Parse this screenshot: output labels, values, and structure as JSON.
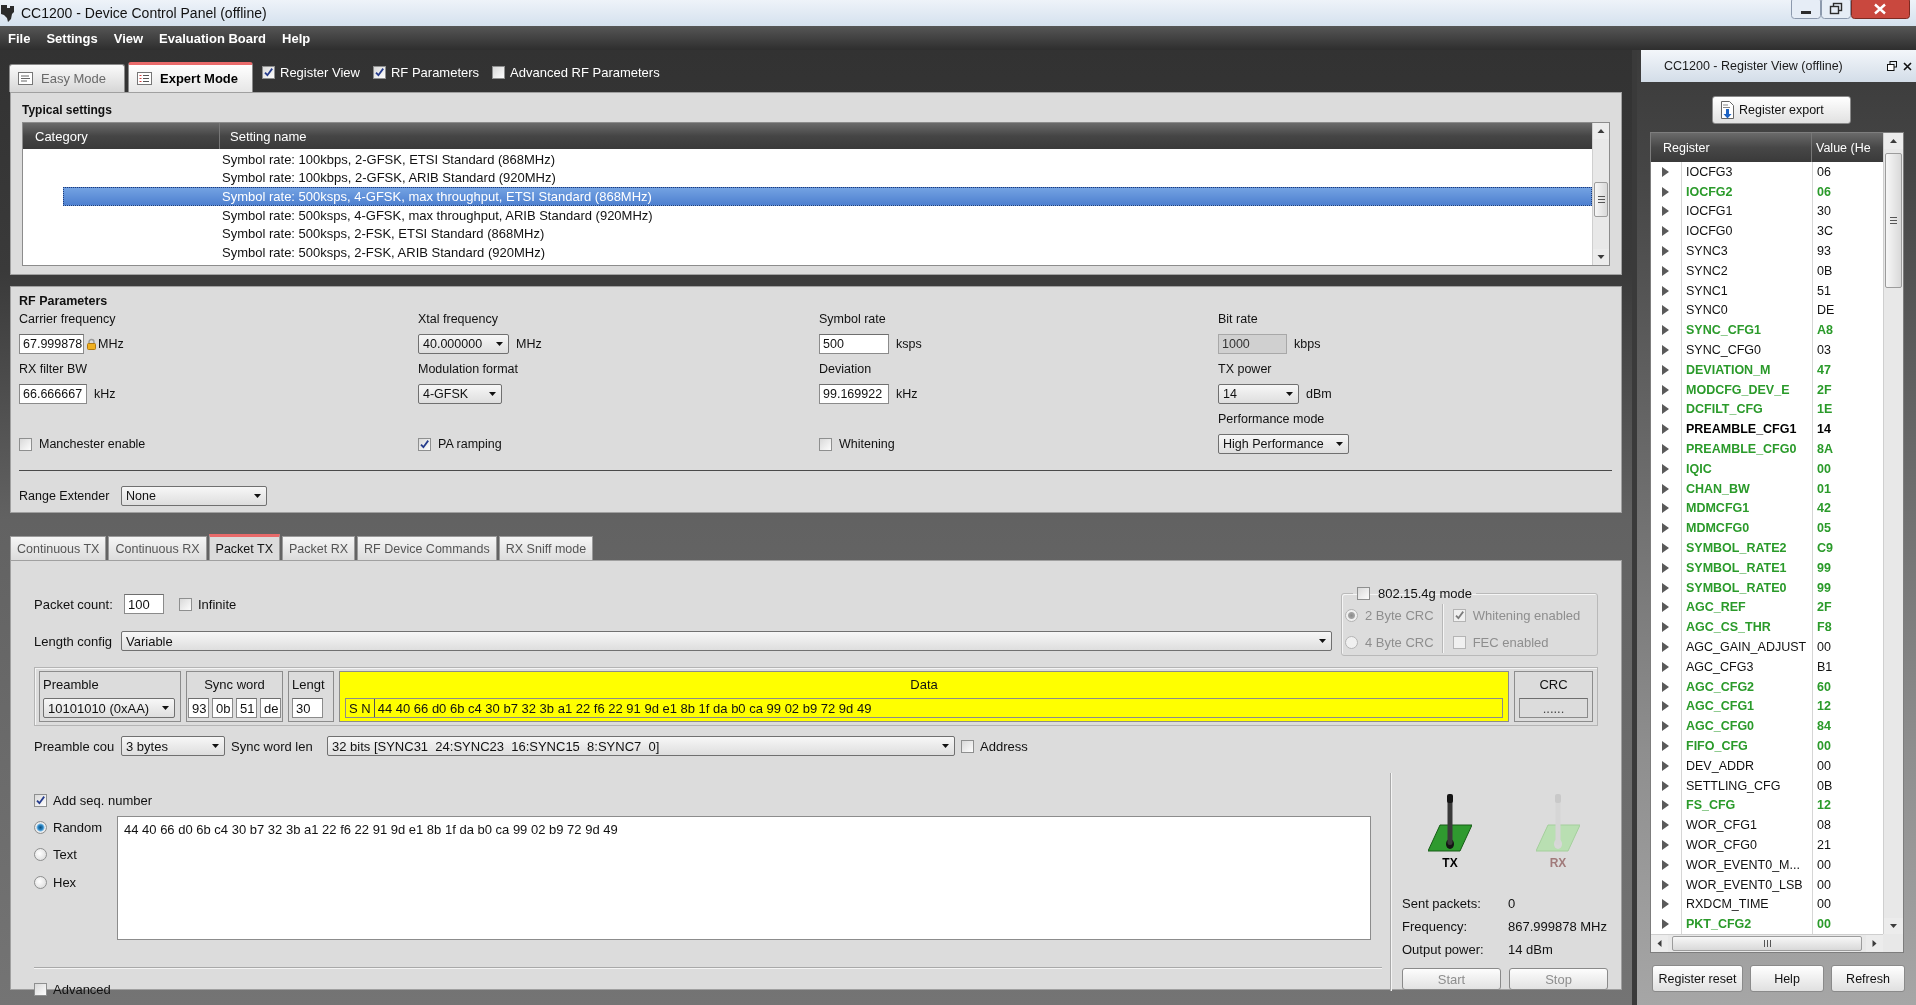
{
  "window": {
    "title": "CC1200 - Device Control Panel (offline)"
  },
  "menu": [
    "File",
    "Settings",
    "View",
    "Evaluation Board",
    "Help"
  ],
  "mode_tabs": [
    {
      "label": "Easy Mode",
      "selected": false
    },
    {
      "label": "Expert Mode",
      "selected": true
    }
  ],
  "view_options": [
    {
      "label": "Register View",
      "checked": true
    },
    {
      "label": "RF Parameters",
      "checked": true
    },
    {
      "label": "Advanced RF Parameters",
      "checked": false
    }
  ],
  "typical_settings": {
    "title": "Typical settings",
    "columns": [
      "Category",
      "Setting name"
    ],
    "rows": [
      {
        "setting_name": "Symbol rate: 100kbps, 2-GFSK, ETSI Standard (868MHz)",
        "selected": false
      },
      {
        "setting_name": "Symbol rate: 100kbps, 2-GFSK, ARIB Standard (920MHz)",
        "selected": false
      },
      {
        "setting_name": "Symbol rate: 500ksps, 4-GFSK, max throughput, ETSI Standard (868MHz)",
        "selected": true
      },
      {
        "setting_name": "Symbol rate: 500ksps, 4-GFSK, max throughput, ARIB Standard (920MHz)",
        "selected": false
      },
      {
        "setting_name": "Symbol rate: 500ksps, 2-FSK, ETSI Standard (868MHz)",
        "selected": false
      },
      {
        "setting_name": "Symbol rate: 500ksps, 2-FSK, ARIB Standard (920MHz)",
        "selected": false
      }
    ]
  },
  "rf_parameters": {
    "title": "RF Parameters",
    "fields": [
      {
        "kind": "input",
        "label": "Carrier frequency",
        "value": "67.999878",
        "unit": "MHz",
        "locked": true
      },
      {
        "kind": "select",
        "label": "Xtal frequency",
        "value": "40.000000",
        "unit": "MHz",
        "locked": false
      },
      {
        "kind": "input",
        "label": "Symbol rate",
        "value": "500",
        "unit": "ksps",
        "locked": false
      },
      {
        "kind": "readonly",
        "label": "Bit rate",
        "value": "1000",
        "unit": "kbps",
        "locked": false
      },
      {
        "kind": "input",
        "label": "RX filter BW",
        "value": "66.666667",
        "unit": "kHz",
        "locked": false
      },
      {
        "kind": "select",
        "label": "Modulation format",
        "value": "4-GFSK",
        "locked": false
      },
      {
        "kind": "input",
        "label": "Deviation",
        "value": "99.169922",
        "unit": "kHz",
        "locked": false
      },
      {
        "kind": "select",
        "label": "TX power",
        "value": "14",
        "unit": "dBm",
        "locked": false
      },
      {
        "kind": "checkbox",
        "label": "Manchester enable",
        "checked": false,
        "locked": false
      },
      {
        "kind": "checkbox",
        "label": "PA ramping",
        "checked": true,
        "locked": false
      },
      {
        "kind": "checkbox",
        "label": "Whitening",
        "checked": false,
        "locked": false
      },
      {
        "kind": "select",
        "label": "Performance mode",
        "value": "High Performance",
        "locked": false
      }
    ],
    "range_extender": {
      "label": "Range Extender",
      "value": "None"
    }
  },
  "packet_tabs": [
    {
      "label": "Continuous TX",
      "selected": false
    },
    {
      "label": "Continuous RX",
      "selected": false
    },
    {
      "label": "Packet TX",
      "selected": true
    },
    {
      "label": "Packet RX",
      "selected": false
    },
    {
      "label": "RF Device Commands",
      "selected": false
    },
    {
      "label": "RX Sniff mode",
      "selected": false
    }
  ],
  "packet_tx": {
    "packet_count": {
      "label": "Packet count:",
      "value": "100"
    },
    "infinite": {
      "label": "Infinite",
      "checked": false
    },
    "length_config": {
      "label": "Length config",
      "value": "Variable"
    },
    "mode_802_15_4g": {
      "label": "802.15.4g mode",
      "checked": false,
      "crc_options": [
        {
          "label": "2 Byte CRC",
          "selected": true
        },
        {
          "label": "4 Byte CRC",
          "selected": false
        }
      ],
      "options": [
        {
          "label": "Whitening enabled",
          "checked": true
        },
        {
          "label": "FEC enabled",
          "checked": false
        }
      ]
    },
    "packet_format": {
      "preamble": {
        "label": "Preamble",
        "value": "10101010 (0xAA)"
      },
      "sync_word": {
        "label": "Sync word",
        "bytes": [
          "93",
          "0b",
          "51",
          "de"
        ]
      },
      "length": {
        "label": "Lengt",
        "value": "30"
      },
      "data": {
        "label": "Data",
        "prefix": "S N",
        "value": "44 40 66 d0 6b c4 30 b7 32 3b a1 22 f6 22 91 9d e1 8b 1f da b0 ca 99 02 b9 72 9d 49"
      },
      "crc": {
        "label": "CRC",
        "value": "......"
      }
    },
    "preamble_count": {
      "label": "Preamble cou",
      "value": "3 bytes"
    },
    "sync_word_length": {
      "label": "Sync word len",
      "value": "32 bits [SYNC31  24:SYNC23  16:SYNC15  8:SYNC7  0]"
    },
    "address": {
      "label": "Address",
      "checked": false
    },
    "add_seq_number": {
      "label": "Add seq. number",
      "checked": true
    },
    "payload_types": [
      {
        "label": "Random",
        "selected": true
      },
      {
        "label": "Text",
        "selected": false
      },
      {
        "label": "Hex",
        "selected": false
      }
    ],
    "payload": "44 40 66 d0 6b c4 30 b7 32 3b a1 22 f6 22 91 9d e1 8b 1f da b0 ca 99 02 b9 72 9d 49",
    "advanced": {
      "label": "Advanced",
      "checked": false
    },
    "radio_indicators": [
      {
        "label": "TX",
        "active": true
      },
      {
        "label": "RX",
        "active": false
      }
    ],
    "status": [
      {
        "label": "Sent packets:",
        "value": "0"
      },
      {
        "label": "Frequency:",
        "value": "867.999878 MHz"
      },
      {
        "label": "Output power:",
        "value": "14 dBm"
      }
    ],
    "buttons": [
      {
        "label": "Start",
        "disabled": true
      },
      {
        "label": "Stop",
        "disabled": true
      }
    ]
  },
  "register_view": {
    "title": "CC1200 - Register View (offline)",
    "export_button": "Register export",
    "columns": [
      "Register",
      "Value (He"
    ],
    "rows": [
      {
        "name": "IOCFG3",
        "value": "06",
        "modified": false,
        "selected": false
      },
      {
        "name": "IOCFG2",
        "value": "06",
        "modified": true,
        "selected": false
      },
      {
        "name": "IOCFG1",
        "value": "30",
        "modified": false,
        "selected": false
      },
      {
        "name": "IOCFG0",
        "value": "3C",
        "modified": false,
        "selected": false
      },
      {
        "name": "SYNC3",
        "value": "93",
        "modified": false,
        "selected": false
      },
      {
        "name": "SYNC2",
        "value": "0B",
        "modified": false,
        "selected": false
      },
      {
        "name": "SYNC1",
        "value": "51",
        "modified": false,
        "selected": false
      },
      {
        "name": "SYNC0",
        "value": "DE",
        "modified": false,
        "selected": false
      },
      {
        "name": "SYNC_CFG1",
        "value": "A8",
        "modified": true,
        "selected": false
      },
      {
        "name": "SYNC_CFG0",
        "value": "03",
        "modified": false,
        "selected": false
      },
      {
        "name": "DEVIATION_M",
        "value": "47",
        "modified": true,
        "selected": false
      },
      {
        "name": "MODCFG_DEV_E",
        "value": "2F",
        "modified": true,
        "selected": false
      },
      {
        "name": "DCFILT_CFG",
        "value": "1E",
        "modified": true,
        "selected": false
      },
      {
        "name": "PREAMBLE_CFG1",
        "value": "14",
        "modified": false,
        "selected": true
      },
      {
        "name": "PREAMBLE_CFG0",
        "value": "8A",
        "modified": true,
        "selected": false
      },
      {
        "name": "IQIC",
        "value": "00",
        "modified": true,
        "selected": false
      },
      {
        "name": "CHAN_BW",
        "value": "01",
        "modified": true,
        "selected": false
      },
      {
        "name": "MDMCFG1",
        "value": "42",
        "modified": true,
        "selected": false
      },
      {
        "name": "MDMCFG0",
        "value": "05",
        "modified": true,
        "selected": false
      },
      {
        "name": "SYMBOL_RATE2",
        "value": "C9",
        "modified": true,
        "selected": false
      },
      {
        "name": "SYMBOL_RATE1",
        "value": "99",
        "modified": true,
        "selected": false
      },
      {
        "name": "SYMBOL_RATE0",
        "value": "99",
        "modified": true,
        "selected": false
      },
      {
        "name": "AGC_REF",
        "value": "2F",
        "modified": true,
        "selected": false
      },
      {
        "name": "AGC_CS_THR",
        "value": "F8",
        "modified": true,
        "selected": false
      },
      {
        "name": "AGC_GAIN_ADJUST",
        "value": "00",
        "modified": false,
        "selected": false
      },
      {
        "name": "AGC_CFG3",
        "value": "B1",
        "modified": false,
        "selected": false
      },
      {
        "name": "AGC_CFG2",
        "value": "60",
        "modified": true,
        "selected": false
      },
      {
        "name": "AGC_CFG1",
        "value": "12",
        "modified": true,
        "selected": false
      },
      {
        "name": "AGC_CFG0",
        "value": "84",
        "modified": true,
        "selected": false
      },
      {
        "name": "FIFO_CFG",
        "value": "00",
        "modified": true,
        "selected": false
      },
      {
        "name": "DEV_ADDR",
        "value": "00",
        "modified": false,
        "selected": false
      },
      {
        "name": "SETTLING_CFG",
        "value": "0B",
        "modified": false,
        "selected": false
      },
      {
        "name": "FS_CFG",
        "value": "12",
        "modified": true,
        "selected": false
      },
      {
        "name": "WOR_CFG1",
        "value": "08",
        "modified": false,
        "selected": false
      },
      {
        "name": "WOR_CFG0",
        "value": "21",
        "modified": false,
        "selected": false
      },
      {
        "name": "WOR_EVENT0_M...",
        "value": "00",
        "modified": false,
        "selected": false
      },
      {
        "name": "WOR_EVENT0_LSB",
        "value": "00",
        "modified": false,
        "selected": false
      },
      {
        "name": "RXDCM_TIME",
        "value": "00",
        "modified": false,
        "selected": false
      },
      {
        "name": "PKT_CFG2",
        "value": "00",
        "modified": true,
        "selected": false
      }
    ],
    "buttons": [
      "Register reset",
      "Help",
      "Refresh"
    ]
  }
}
